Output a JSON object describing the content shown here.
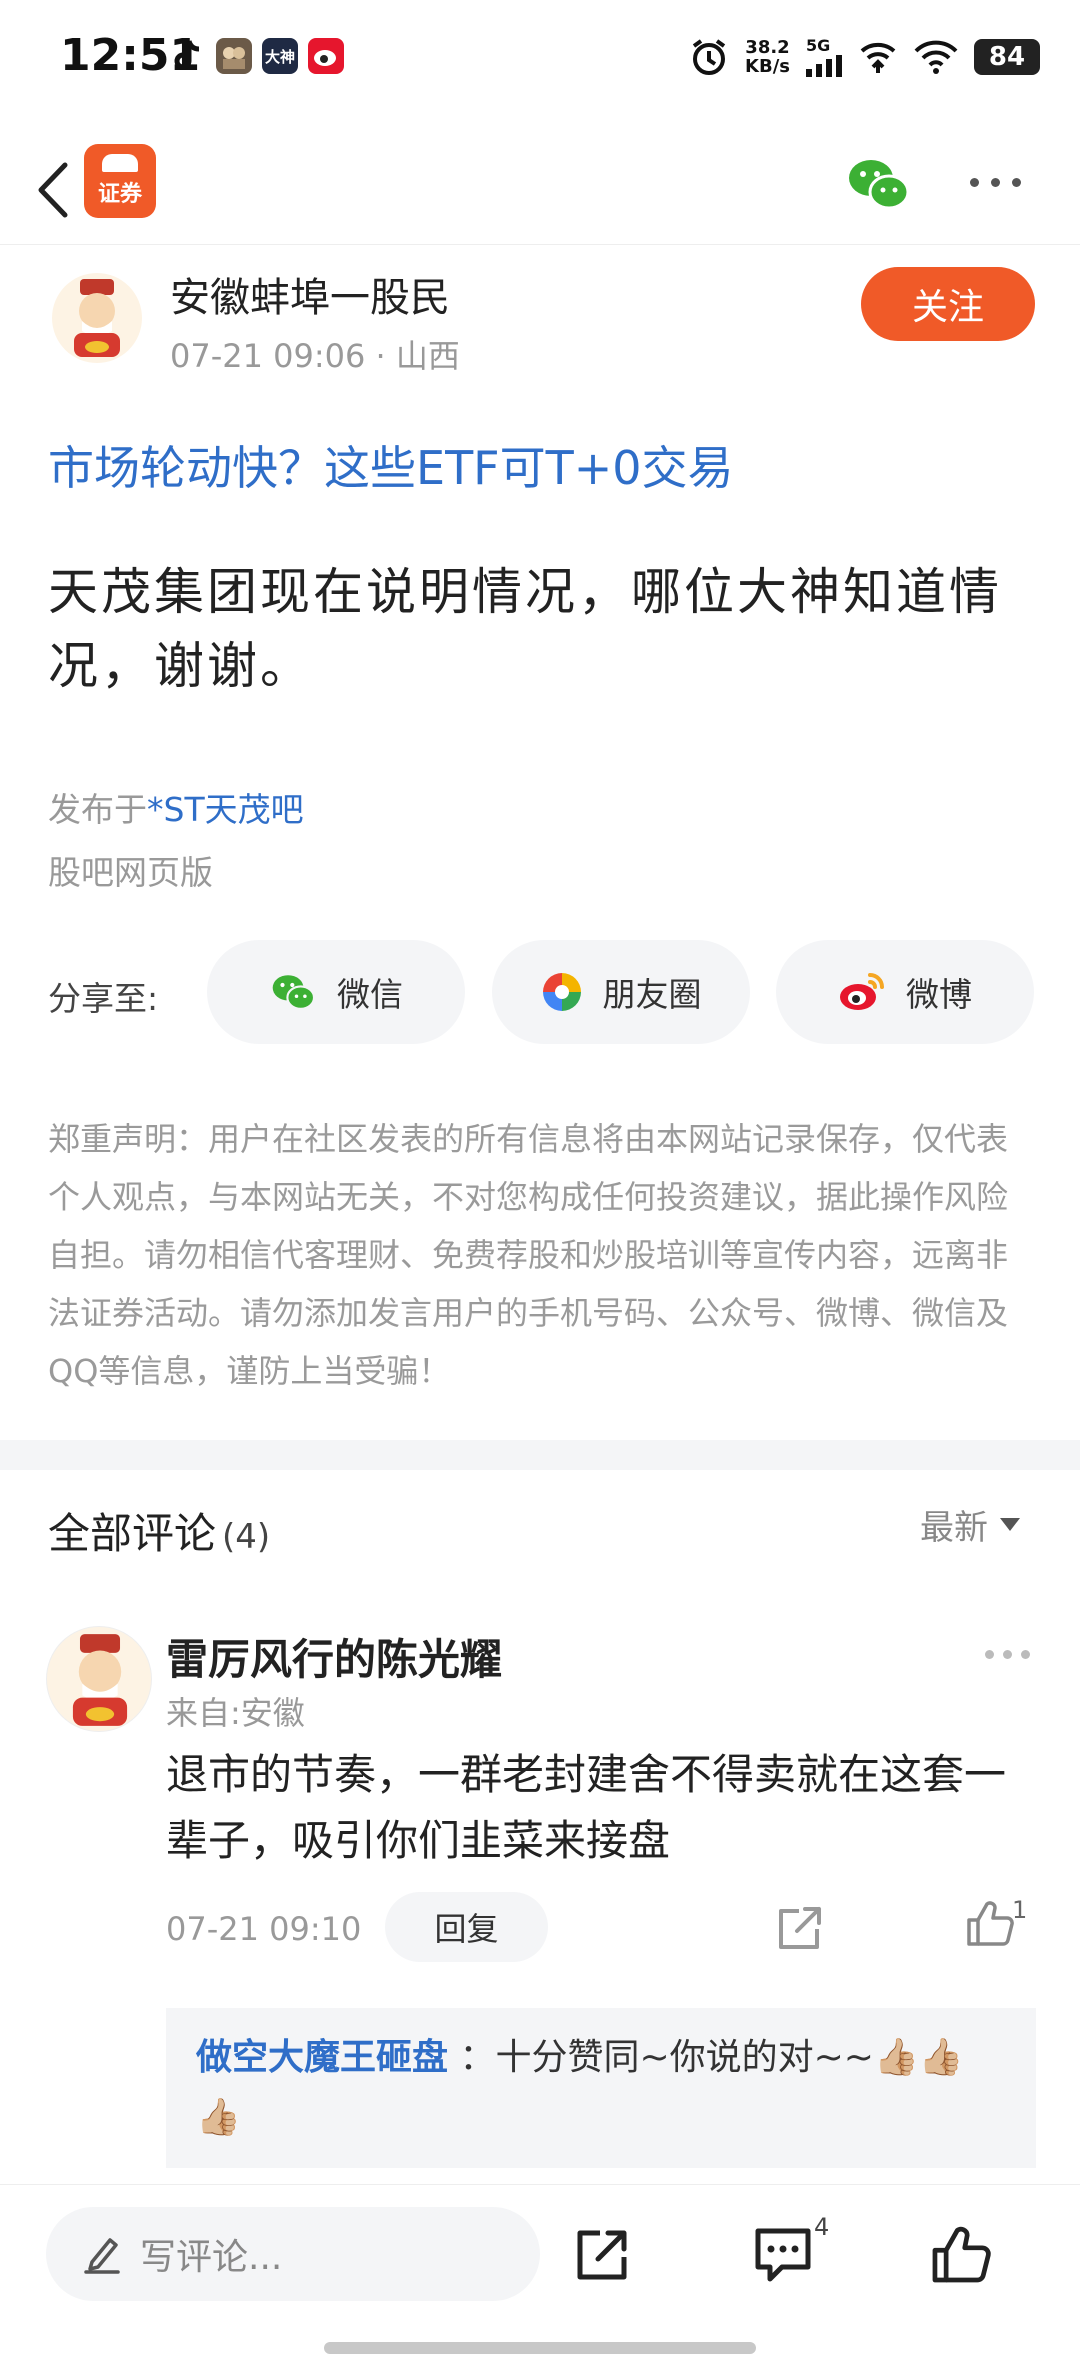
{
  "status_bar": {
    "time": "12:51",
    "app_icons": [
      "tiktok-icon",
      "game-app-icon",
      "dashen-app-icon",
      "weibo-app-icon"
    ],
    "dashen_label": "大神",
    "speed_value": "38.2",
    "speed_unit": "KB/s",
    "network": "5G",
    "battery": "84"
  },
  "nav": {
    "logo_text": "证券",
    "icons": [
      "back-arrow-icon",
      "wechat-icon",
      "more-icon"
    ]
  },
  "author": {
    "name": "安徽蚌埠一股民",
    "meta": "07-21 09:06 · 山西",
    "follow_label": "关注"
  },
  "post": {
    "promo_title": "市场轮动快？这些ETF可T+0交易",
    "body": "天茂集团现在说明情况，哪位大神知道情况，谢谢。",
    "posted_in_prefix": "发布于",
    "posted_in_bar": "*ST天茂吧",
    "source": "股吧网页版"
  },
  "share": {
    "label": "分享至:",
    "buttons": [
      {
        "label": "微信",
        "icon": "wechat-icon"
      },
      {
        "label": "朋友圈",
        "icon": "moments-icon"
      },
      {
        "label": "微博",
        "icon": "weibo-icon"
      }
    ]
  },
  "disclaimer": "郑重声明：用户在社区发表的所有信息将由本网站记录保存，仅代表个人观点，与本网站无关，不对您构成任何投资建议，据此操作风险自担。请勿相信代客理财、免费荐股和炒股培训等宣传内容，远离非法证券活动。请勿添加发言用户的手机号码、公众号、微博、微信及QQ等信息，谨防上当受骗！",
  "comments": {
    "title": "全部评论",
    "count": "(4)",
    "sort_label": "最新",
    "items": [
      {
        "name": "雷厉风行的陈光耀",
        "location": "来自:安徽",
        "text": "退市的节奏，一群老封建舍不得卖就在这套一辈子，吸引你们韭菜来接盘",
        "time": "07-21 09:10",
        "reply_label": "回复",
        "likes": "1",
        "sub_reply": {
          "name": "做空大魔王砸盘",
          "text": "：十分赞同~你说的对~~👍🏼👍🏼👍🏼"
        }
      }
    ]
  },
  "bottom_bar": {
    "input_placeholder": "写评论...",
    "comment_count": "4",
    "icons": [
      "pencil-icon",
      "share-icon",
      "comment-icon",
      "thumbs-up-icon"
    ]
  },
  "colors": {
    "accent": "#f05a28",
    "link": "#2f6ec8",
    "muted": "#999999",
    "wechat_green": "#3cb034",
    "weibo_red": "#e6162d"
  }
}
